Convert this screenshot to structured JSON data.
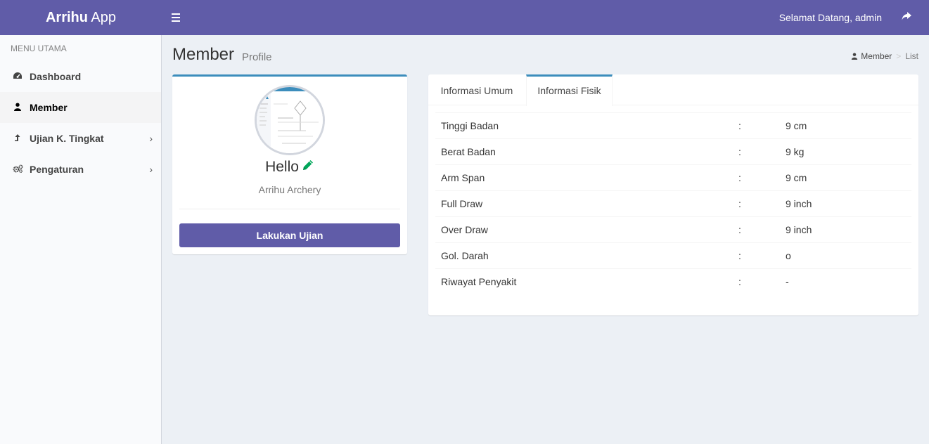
{
  "header": {
    "logo_bold": "Arrihu",
    "logo_rest": " App",
    "welcome": "Selamat Datang, admin"
  },
  "sidebar": {
    "menu_header": "MENU UTAMA",
    "items": [
      {
        "label": "Dashboard",
        "icon": "dashboard-icon",
        "active": false,
        "has_submenu": false
      },
      {
        "label": "Member",
        "icon": "user-icon",
        "active": true,
        "has_submenu": false
      },
      {
        "label": "Ujian K. Tingkat",
        "icon": "level-up-icon",
        "active": false,
        "has_submenu": true
      },
      {
        "label": "Pengaturan",
        "icon": "gears-icon",
        "active": false,
        "has_submenu": true
      }
    ]
  },
  "page": {
    "title": "Member",
    "subtitle": "Profile",
    "breadcrumb": [
      "Member",
      "List"
    ]
  },
  "profile": {
    "greeting": "Hello",
    "organization": "Arrihu Archery",
    "button_label": "Lakukan Ujian"
  },
  "tabs": {
    "items": [
      "Informasi Umum",
      "Informasi Fisik"
    ],
    "active": "Informasi Fisik"
  },
  "physical_info": {
    "separator": ":",
    "rows": [
      {
        "label": "Tinggi Badan",
        "value": "9 cm"
      },
      {
        "label": "Berat Badan",
        "value": "9 kg"
      },
      {
        "label": "Arm Span",
        "value": "9 cm"
      },
      {
        "label": "Full Draw",
        "value": "9 inch"
      },
      {
        "label": "Over Draw",
        "value": "9 inch"
      },
      {
        "label": "Gol. Darah",
        "value": "o"
      },
      {
        "label": "Riwayat Penyakit",
        "value": "-"
      }
    ]
  },
  "colors": {
    "primary": "#605ca8",
    "accent_border": "#3c8dbc",
    "edit_icon": "#00a65a",
    "background": "#ecf0f5"
  }
}
